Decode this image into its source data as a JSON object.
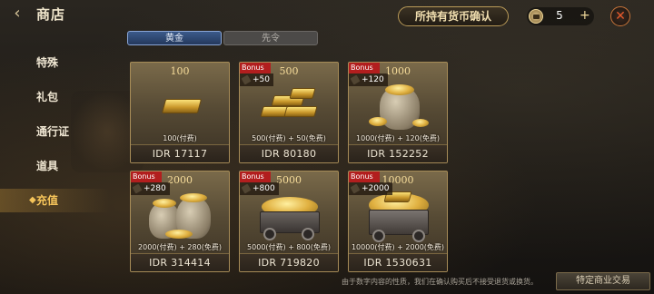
{
  "header": {
    "title": "商店",
    "confirm_label": "所持有货币确认",
    "currency_count": "5",
    "plus_symbol": "+",
    "close_symbol": "✕",
    "back_symbol": "‹"
  },
  "tabs": [
    {
      "label": "黄金",
      "active": true
    },
    {
      "label": "先令",
      "active": false
    }
  ],
  "sidebar": {
    "items": [
      {
        "label": "特殊",
        "active": false
      },
      {
        "label": "礼包",
        "active": false
      },
      {
        "label": "通行证",
        "active": false
      },
      {
        "label": "道具",
        "active": false
      },
      {
        "label": "充值",
        "active": true
      }
    ]
  },
  "products": [
    {
      "qty": "100",
      "bonus_tag": "",
      "bonus": "",
      "breakdown": "100(付费)",
      "price": "IDR 17117",
      "art": "bar-small"
    },
    {
      "qty": "500",
      "bonus_tag": "Bonus",
      "bonus": "+50",
      "breakdown": "500(付费) + 50(免费)",
      "price": "IDR 80180",
      "art": "bar-stack"
    },
    {
      "qty": "1000",
      "bonus_tag": "Bonus",
      "bonus": "+120",
      "breakdown": "1000(付费) + 120(免费)",
      "price": "IDR 152252",
      "art": "sack"
    },
    {
      "qty": "2000",
      "bonus_tag": "Bonus",
      "bonus": "+280",
      "breakdown": "2000(付费) + 280(免费)",
      "price": "IDR 314414",
      "art": "sacks"
    },
    {
      "qty": "5000",
      "bonus_tag": "Bonus",
      "bonus": "+800",
      "breakdown": "5000(付费) + 800(免费)",
      "price": "IDR 719820",
      "art": "cart"
    },
    {
      "qty": "10000",
      "bonus_tag": "Bonus",
      "bonus": "+2000",
      "breakdown": "10000(付费) + 2000(免费)",
      "price": "IDR 1530631",
      "art": "chest"
    }
  ],
  "footer": {
    "note": "由于数字内容的性质，我们在确认购买后不接受退货或换货。",
    "button_label": "特定商业交易"
  },
  "colors": {
    "accent_gold": "#f5c45a",
    "bonus_red": "#b21e1e",
    "tab_active": "#3b5a8a",
    "close_orange": "#e5592c"
  }
}
